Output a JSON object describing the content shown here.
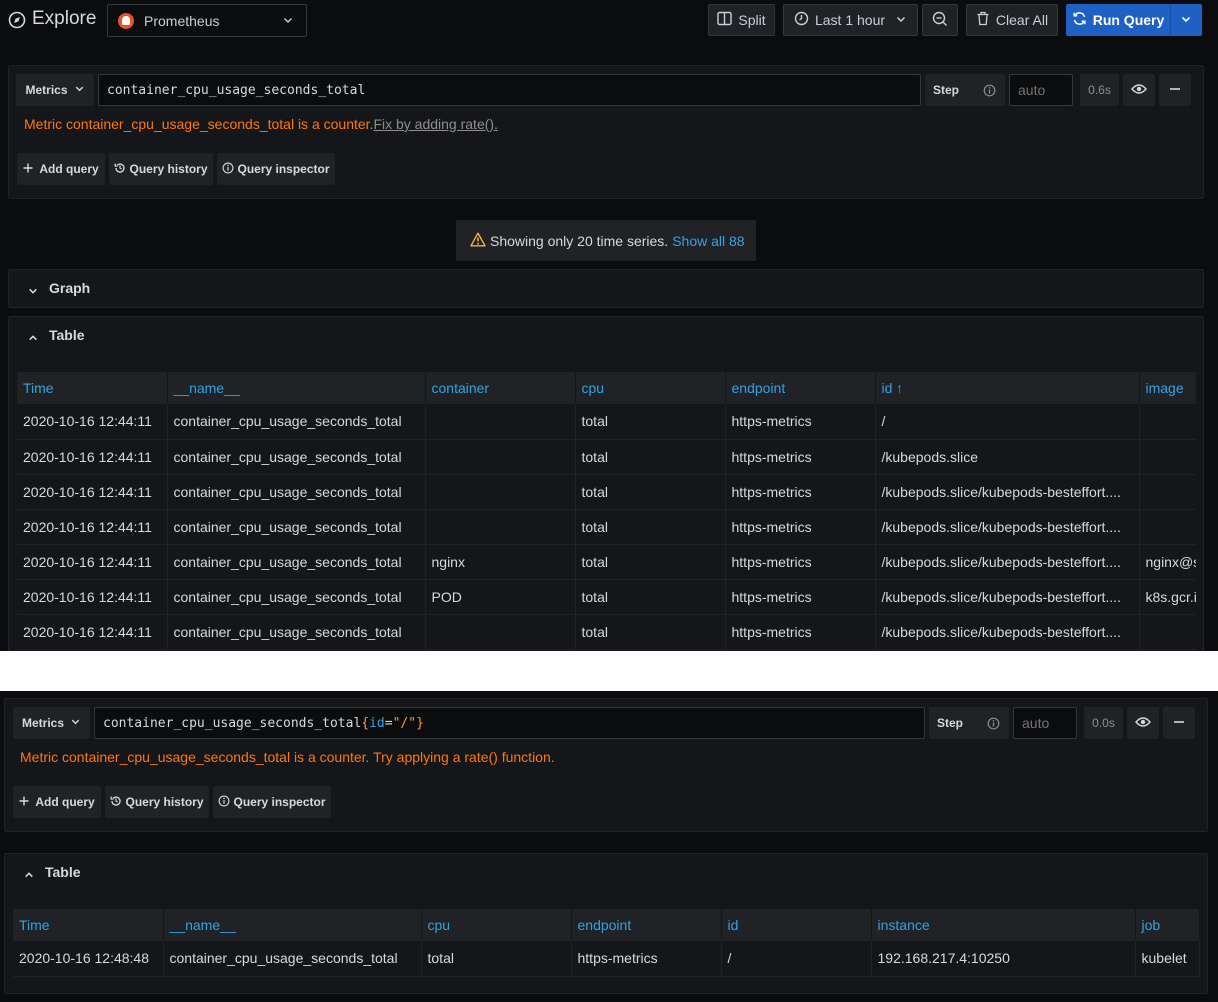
{
  "header": {
    "title": "Explore",
    "datasource": "Prometheus",
    "split_label": "Split",
    "time_range": "Last 1 hour",
    "clear_label": "Clear All",
    "run_label": "Run Query"
  },
  "query1": {
    "metrics_label": "Metrics",
    "query": "container_cpu_usage_seconds_total",
    "step_label": "Step",
    "step_placeholder": "auto",
    "duration": "0.6s",
    "warning": "Metric container_cpu_usage_seconds_total is a counter.",
    "fix_link": "Fix by adding rate().",
    "add_query": "Add query",
    "query_history": "Query history",
    "query_inspector": "Query inspector"
  },
  "banner": {
    "text": "Showing only 20 time series.",
    "link": "Show all 88"
  },
  "graph_section": {
    "title": "Graph"
  },
  "table1": {
    "title": "Table",
    "columns": [
      "Time",
      "__name__",
      "container",
      "cpu",
      "endpoint",
      "id",
      "image"
    ],
    "sort_indicator": "↑",
    "rows": [
      [
        "2020-10-16 12:44:11",
        "container_cpu_usage_seconds_total",
        "",
        "total",
        "https-metrics",
        "/",
        ""
      ],
      [
        "2020-10-16 12:44:11",
        "container_cpu_usage_seconds_total",
        "",
        "total",
        "https-metrics",
        "/kubepods.slice",
        ""
      ],
      [
        "2020-10-16 12:44:11",
        "container_cpu_usage_seconds_total",
        "",
        "total",
        "https-metrics",
        "/kubepods.slice/kubepods-besteffort....",
        ""
      ],
      [
        "2020-10-16 12:44:11",
        "container_cpu_usage_seconds_total",
        "",
        "total",
        "https-metrics",
        "/kubepods.slice/kubepods-besteffort....",
        ""
      ],
      [
        "2020-10-16 12:44:11",
        "container_cpu_usage_seconds_total",
        "nginx",
        "total",
        "https-metrics",
        "/kubepods.slice/kubepods-besteffort....",
        "nginx@s"
      ],
      [
        "2020-10-16 12:44:11",
        "container_cpu_usage_seconds_total",
        "POD",
        "total",
        "https-metrics",
        "/kubepods.slice/kubepods-besteffort....",
        "k8s.gcr.i"
      ],
      [
        "2020-10-16 12:44:11",
        "container_cpu_usage_seconds_total",
        "",
        "total",
        "https-metrics",
        "/kubepods.slice/kubepods-besteffort....",
        ""
      ]
    ]
  },
  "query2": {
    "metrics_label": "Metrics",
    "query_metric": "container_cpu_usage_seconds_total",
    "query_open": "{",
    "query_key": "id",
    "query_eq": "=",
    "query_value": "\"/\"",
    "query_close": "}",
    "step_label": "Step",
    "step_placeholder": "auto",
    "duration": "0.0s",
    "warning": "Metric container_cpu_usage_seconds_total is a counter. Try applying a rate() function.",
    "add_query": "Add query",
    "query_history": "Query history",
    "query_inspector": "Query inspector"
  },
  "table2": {
    "title": "Table",
    "columns": [
      "Time",
      "__name__",
      "cpu",
      "endpoint",
      "id",
      "instance",
      "job"
    ],
    "rows": [
      [
        "2020-10-16 12:48:48",
        "container_cpu_usage_seconds_total",
        "total",
        "https-metrics",
        "/",
        "192.168.217.4:10250",
        "kubelet"
      ]
    ]
  },
  "colors": {
    "background": "#0b0c0e",
    "panel": "#141619",
    "accent_blue": "#1f60c4",
    "header_blue": "#33a2e5",
    "warning_orange": "#ff780a"
  }
}
